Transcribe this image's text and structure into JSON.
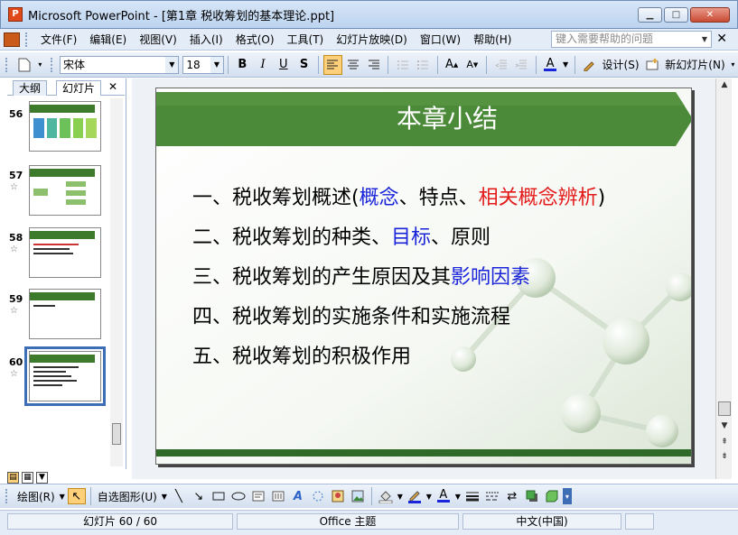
{
  "window": {
    "title": "Microsoft PowerPoint - [第1章 税收筹划的基本理论.ppt]",
    "minimize_glyph": "▁",
    "maximize_glyph": "□",
    "close_glyph": "✕"
  },
  "menu": {
    "items": [
      "文件(F)",
      "编辑(E)",
      "视图(V)",
      "插入(I)",
      "格式(O)",
      "工具(T)",
      "幻灯片放映(D)",
      "窗口(W)",
      "帮助(H)"
    ],
    "help_placeholder": "键入需要帮助的问题",
    "close_glyph": "✕"
  },
  "toolbar": {
    "font_name": "宋体",
    "font_size": "18",
    "bold": "B",
    "italic": "I",
    "underline": "U",
    "shadow": "S",
    "design_label": "设计(S)",
    "new_slide_label": "新幻灯片(N)"
  },
  "left_pane": {
    "tab_outline": "大纲",
    "tab_slides": "幻灯片",
    "close_glyph": "✕",
    "slides": [
      {
        "number": "56",
        "star": ""
      },
      {
        "number": "57",
        "star": "☆"
      },
      {
        "number": "58",
        "star": "☆"
      },
      {
        "number": "59",
        "star": "☆"
      },
      {
        "number": "60",
        "star": "☆"
      }
    ],
    "selected_slide": "60"
  },
  "slide": {
    "title": "本章小结",
    "lines": [
      {
        "segments": [
          {
            "text": "一、税收筹划概述(",
            "color": "black"
          },
          {
            "text": "概念",
            "color": "blue"
          },
          {
            "text": "、特点、",
            "color": "black"
          },
          {
            "text": "相关概念辨析",
            "color": "red"
          },
          {
            "text": ")",
            "color": "black"
          }
        ]
      },
      {
        "segments": [
          {
            "text": "二、税收筹划的种类、",
            "color": "black"
          },
          {
            "text": "目标",
            "color": "blue"
          },
          {
            "text": "、原则",
            "color": "black"
          }
        ]
      },
      {
        "segments": [
          {
            "text": "三、税收筹划的产生原因及其",
            "color": "black"
          },
          {
            "text": "影响因素",
            "color": "blue"
          }
        ]
      },
      {
        "segments": [
          {
            "text": "四、税收筹划的实施条件和实施流程",
            "color": "black"
          }
        ]
      },
      {
        "segments": [
          {
            "text": "五、税收筹划的积极作用",
            "color": "black"
          }
        ]
      }
    ]
  },
  "draw_toolbar": {
    "draw_label": "绘图(R)",
    "autoshapes_label": "自选图形(U)"
  },
  "status": {
    "slide_indicator": "幻灯片 60 / 60",
    "theme": "Office 主题",
    "language": "中文(中国)"
  },
  "colors": {
    "title_green": "#3e7a2c",
    "text_blue": "#1a24d8",
    "text_red": "#e41b1b"
  }
}
